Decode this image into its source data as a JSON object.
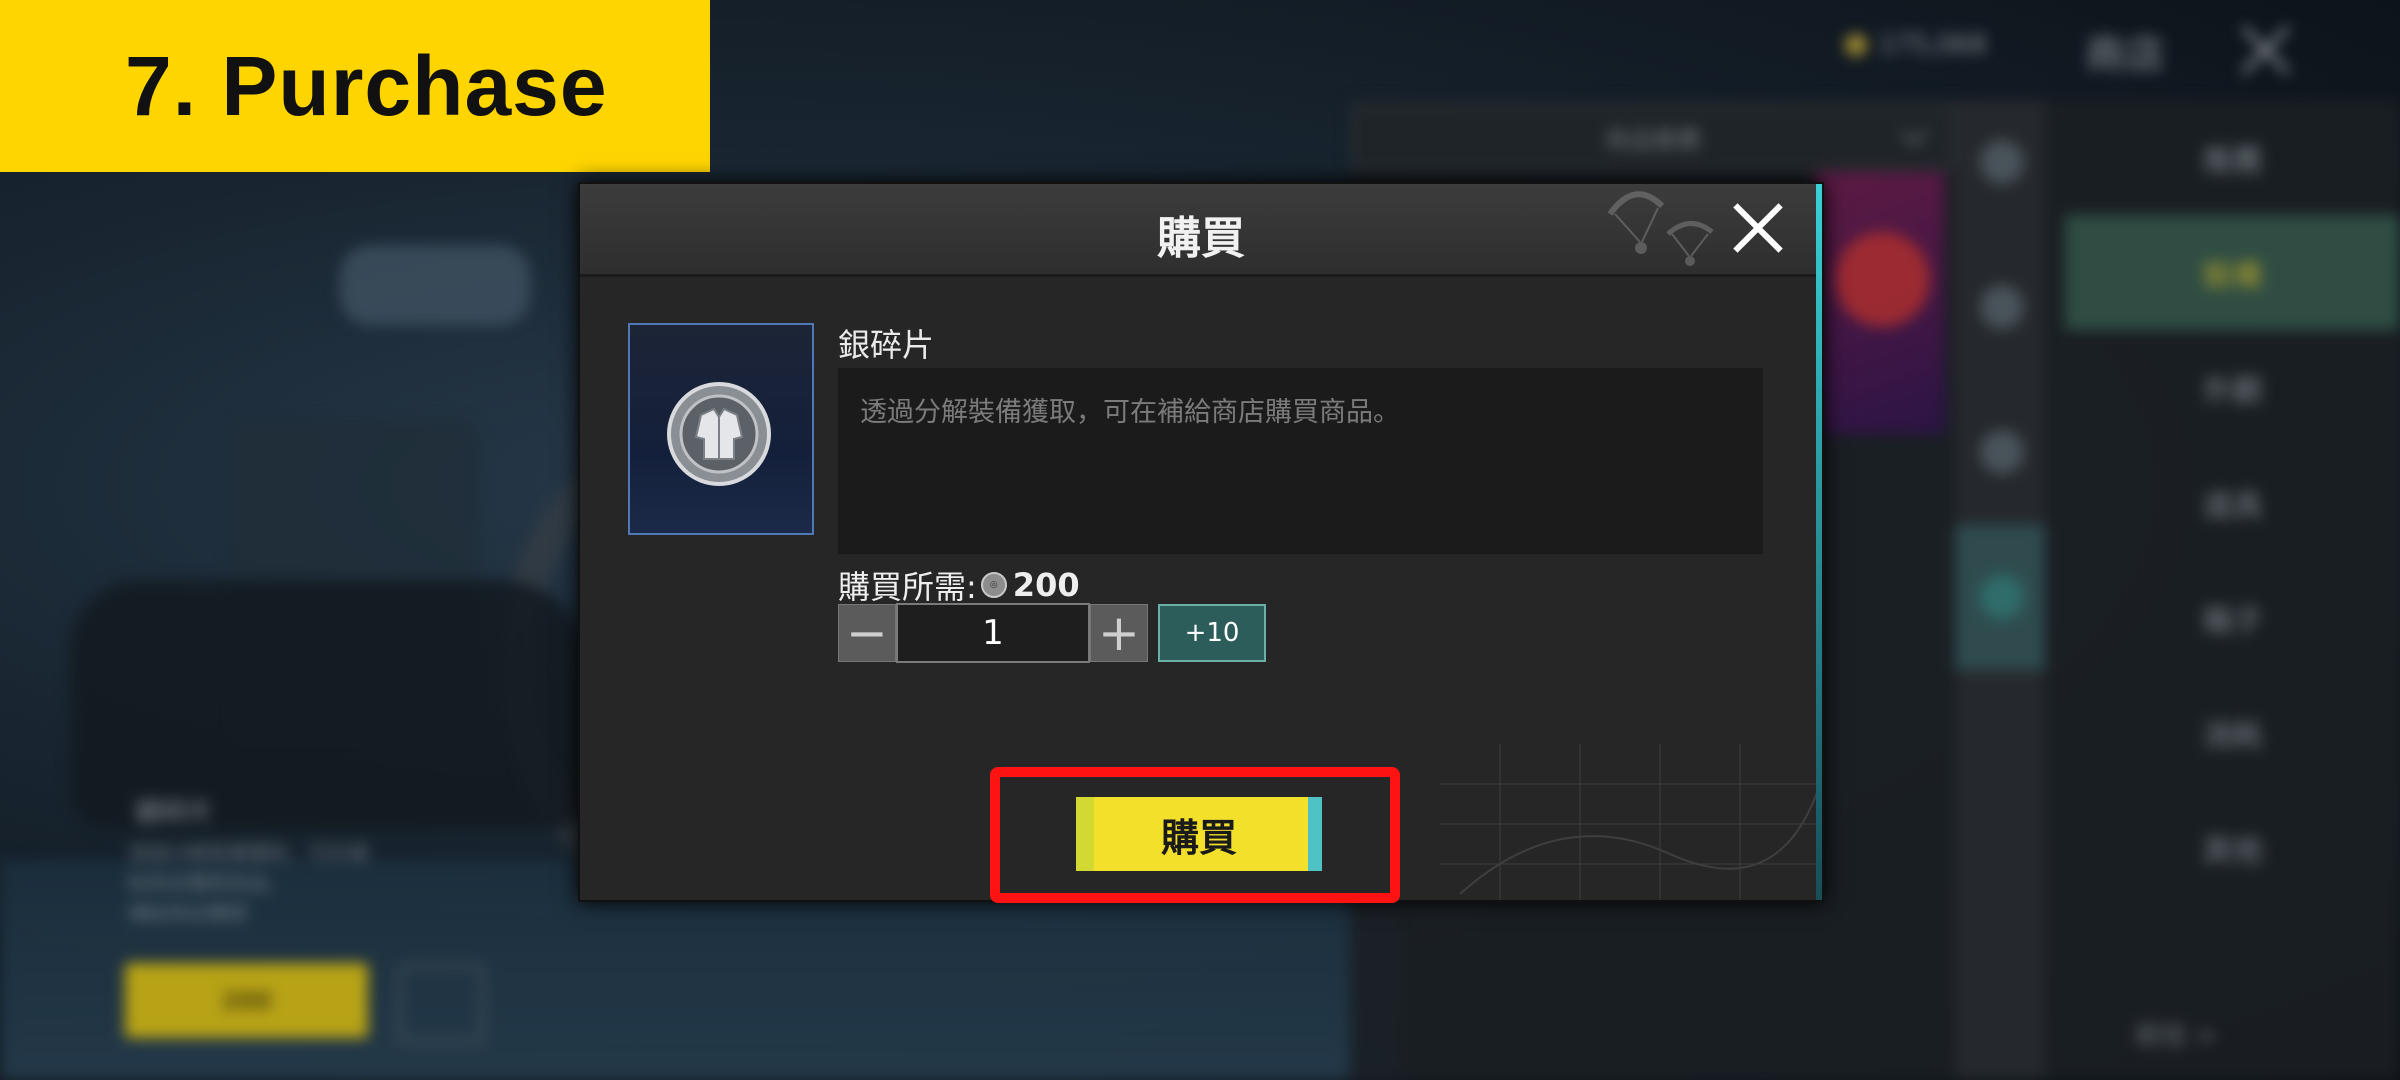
{
  "banner": {
    "title": "7. Purchase"
  },
  "background": {
    "currency_amount": "175,068",
    "store_title": "商店",
    "dropdown_label": "商品推薦",
    "side_menu": [
      "推薦",
      "裝備",
      "外觀",
      "道具",
      "箱子",
      "消耗",
      "其他"
    ],
    "side_menu_active_index": 1,
    "item_name": "銀碎片",
    "item_desc": [
      "透過分解裝備獲取，可在補",
      "給商店購買商品。",
      "補給商店購買"
    ],
    "price_label": "200",
    "more_link": "前往 >"
  },
  "dialog": {
    "title": "購買",
    "item": {
      "name": "銀碎片",
      "description": "透過分解裝備獲取，可在補給商店購買商品。",
      "icon": "silver-fragment-medal-icon"
    },
    "cost_label": "購買所需:",
    "cost_value": "200",
    "quantity": "1",
    "minus_label": "−",
    "plus_label": "+",
    "plus10_label": "+10",
    "buy_label": "購買"
  },
  "colors": {
    "banner": "#ffd500",
    "buy_button": "#f3e02a",
    "highlight": "#ff1212",
    "plus10": "#2c5d5b"
  }
}
